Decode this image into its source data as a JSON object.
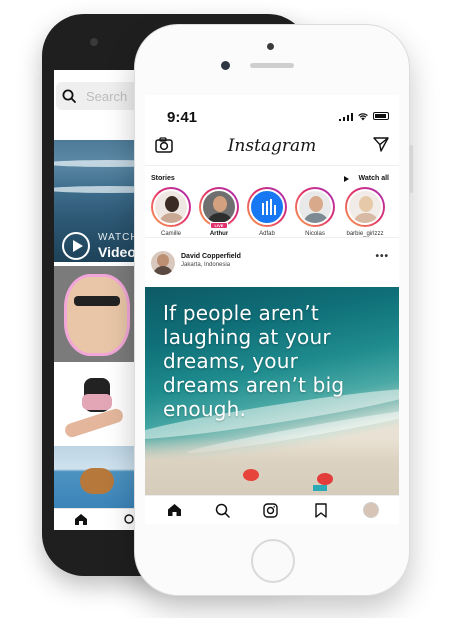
{
  "back_phone": {
    "search_placeholder": "Search",
    "video_tile": {
      "line1": "WATCH",
      "line2": "Video"
    }
  },
  "front_phone": {
    "status_bar": {
      "time": "9:41"
    },
    "header": {
      "logo": "Instagram"
    },
    "stories": {
      "label": "Stories",
      "watch_all": "Watch all",
      "items": [
        {
          "name": "Camille",
          "ring": "gradient"
        },
        {
          "name": "Arthur",
          "ring": "gradient",
          "live": "LIVE"
        },
        {
          "name": "Adfab",
          "ring": "gradient"
        },
        {
          "name": "Nicolas",
          "ring": "gradient"
        },
        {
          "name": "barbie_girlzzz",
          "ring": "gradient"
        }
      ]
    },
    "post": {
      "username": "David Copperfield",
      "location": "Jakarta, Indonesia",
      "more": "•••",
      "quote": "If people aren’t laughing at your dreams, your dreams aren’t big enough."
    },
    "tabs": [
      "home",
      "search",
      "camera",
      "saved",
      "profile"
    ]
  },
  "colors": {
    "story_ring_gradient": [
      "#f9a04b",
      "#e1306c",
      "#a02dbf"
    ],
    "adfab_blue": "#1877f2",
    "live_badge": "#e1306c",
    "back_phone_body": "#1f1f1f",
    "front_phone_body": "#fbfbfb"
  }
}
